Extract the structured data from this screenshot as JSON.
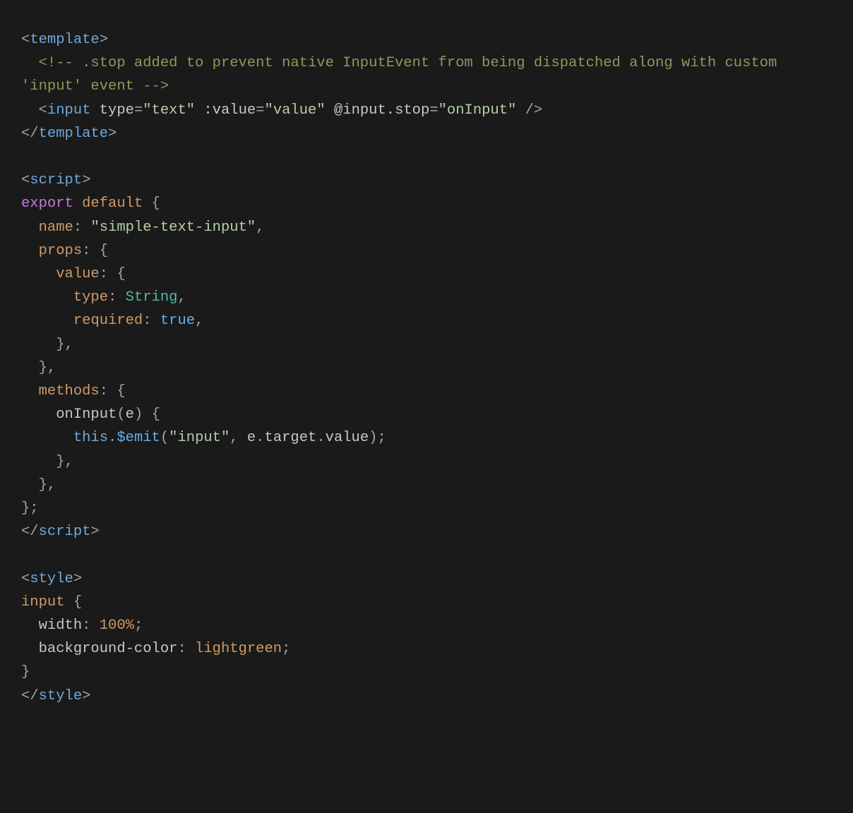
{
  "code": {
    "t01": "<",
    "t02": "template",
    "t03": ">",
    "t04": "<!-- .stop added to prevent native InputEvent from being dispatched along with custom 'input' event -->",
    "t05": "<",
    "t06": "input",
    "t07": " ",
    "t08": "type",
    "t09": "=",
    "t10": "\"text\"",
    "t11": " ",
    "t12": ":value",
    "t13": "=",
    "t14": "\"value\"",
    "t15": " ",
    "t16": "@input.stop",
    "t17": "=",
    "t18": "\"onInput\"",
    "t19": " />",
    "t20": "</",
    "t21": "template",
    "t22": ">",
    "s01": "<",
    "s02": "script",
    "s03": ">",
    "s04": "export",
    "s05": " ",
    "s06": "default",
    "s07": " {",
    "s08": "name",
    "s09": ": ",
    "s10": "\"simple-text-input\"",
    "s11": ",",
    "s12": "props",
    "s13": ": {",
    "s14": "value",
    "s15": ": {",
    "s16": "type",
    "s17": ": ",
    "s18": "String",
    "s19": ",",
    "s20": "required",
    "s21": ": ",
    "s22": "true",
    "s23": ",",
    "s24": "},",
    "s25": "},",
    "s26": "methods",
    "s27": ": {",
    "s28": "onInput",
    "s29": "(",
    "s30": "e",
    "s31": ") {",
    "s32": "this",
    "s33": ".",
    "s34": "$emit",
    "s35": "(",
    "s36": "\"input\"",
    "s37": ", ",
    "s38": "e",
    "s39": ".",
    "s40": "target",
    "s41": ".",
    "s42": "value",
    "s43": ");",
    "s44": "},",
    "s45": "},",
    "s46": "};",
    "s47": "</",
    "s48": "script",
    "s49": ">",
    "st01": "<",
    "st02": "style",
    "st03": ">",
    "st04": "input",
    "st05": " {",
    "st06": "width",
    "st07": ": ",
    "st08": "100%",
    "st09": ";",
    "st10": "background-color",
    "st11": ": ",
    "st12": "lightgreen",
    "st13": ";",
    "st14": "}",
    "st15": "</",
    "st16": "style",
    "st17": ">"
  }
}
